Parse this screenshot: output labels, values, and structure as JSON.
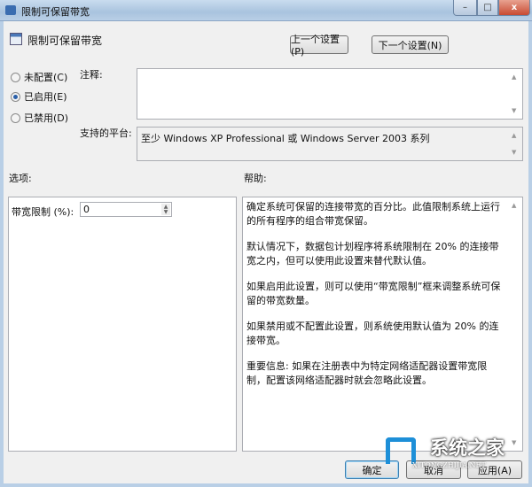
{
  "window": {
    "title": "限制可保留带宽",
    "minimize": "–",
    "maximize": "□",
    "close": "x"
  },
  "header": {
    "title": "限制可保留带宽",
    "prev_button": "上一个设置(P)",
    "next_button": "下一个设置(N)"
  },
  "state": {
    "options": [
      {
        "label": "未配置(C)",
        "selected": false
      },
      {
        "label": "已启用(E)",
        "selected": true
      },
      {
        "label": "已禁用(D)",
        "selected": false
      }
    ]
  },
  "comment": {
    "label": "注释:",
    "value": ""
  },
  "platform": {
    "label": "支持的平台:",
    "value": "至少 Windows XP Professional 或 Windows Server 2003 系列"
  },
  "options_section": {
    "label": "选项:",
    "field_label": "带宽限制 (%):",
    "field_value": "0"
  },
  "help_section": {
    "label": "帮助:",
    "paragraphs": [
      "确定系统可保留的连接带宽的百分比。此值限制系统上运行的所有程序的组合带宽保留。",
      "默认情况下，数据包计划程序将系统限制在 20% 的连接带宽之内，但可以使用此设置来替代默认值。",
      "如果启用此设置，则可以使用“带宽限制”框来调整系统可保留的带宽数量。",
      "如果禁用或不配置此设置，则系统使用默认值为 20% 的连接带宽。",
      "重要信息: 如果在注册表中为特定网络适配器设置带宽限制，配置该网络适配器时就会忽略此设置。"
    ]
  },
  "footer": {
    "ok": "确定",
    "cancel": "取消",
    "apply": "应用(A)"
  },
  "watermark": {
    "name": "系统之家",
    "url": "XITONGZHIJIA.NET"
  }
}
